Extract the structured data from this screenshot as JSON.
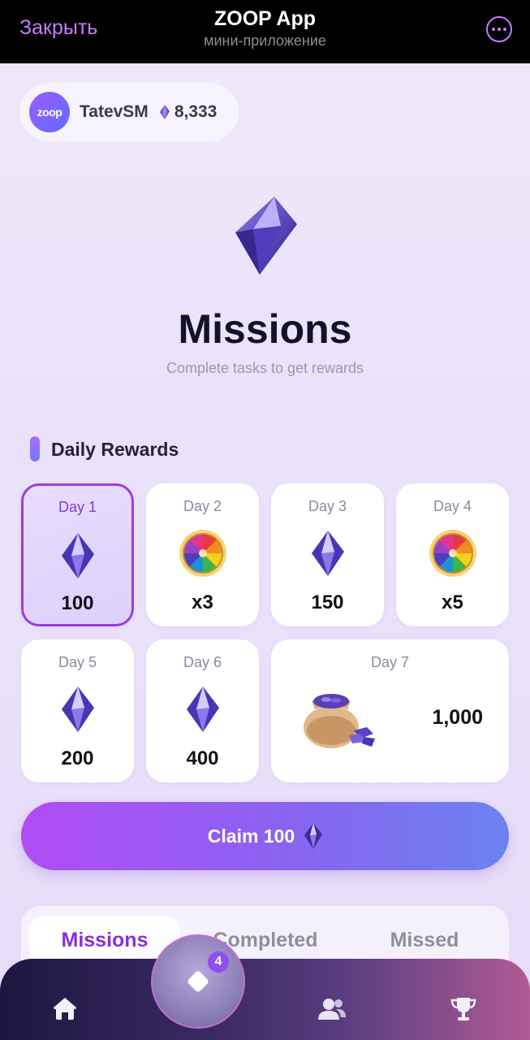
{
  "topbar": {
    "close_label": "Закрыть",
    "title": "ZOOP App",
    "subtitle": "мини-приложение"
  },
  "profile": {
    "logo_text": "zoop",
    "username": "TatevSM",
    "balance": "8,333"
  },
  "header": {
    "title": "Missions",
    "subtitle": "Complete tasks to get rewards"
  },
  "daily_rewards": {
    "title": "Daily Rewards",
    "days": [
      {
        "label": "Day 1",
        "value": "100",
        "icon": "gem-icon",
        "active": true
      },
      {
        "label": "Day 2",
        "value": "x3",
        "icon": "wheel-icon"
      },
      {
        "label": "Day 3",
        "value": "150",
        "icon": "gem-icon"
      },
      {
        "label": "Day 4",
        "value": "x5",
        "icon": "wheel-icon"
      },
      {
        "label": "Day 5",
        "value": "200",
        "icon": "gem-icon"
      },
      {
        "label": "Day 6",
        "value": "400",
        "icon": "gem-icon"
      },
      {
        "label": "Day 7",
        "value": "1,000",
        "icon": "gem-bag-icon"
      }
    ]
  },
  "claim_button": {
    "label": "Claim 100"
  },
  "tabs": [
    {
      "label": "Missions",
      "active": true
    },
    {
      "label": "Completed"
    },
    {
      "label": "Missed"
    }
  ],
  "bottom_nav": {
    "items": [
      "home-icon",
      "missions-icon",
      "friends-icon",
      "trophy-icon"
    ],
    "badge": "4"
  },
  "colors": {
    "accent": "#8a2ed6",
    "close": "#c77dff",
    "gem": "#5a3fc0"
  }
}
